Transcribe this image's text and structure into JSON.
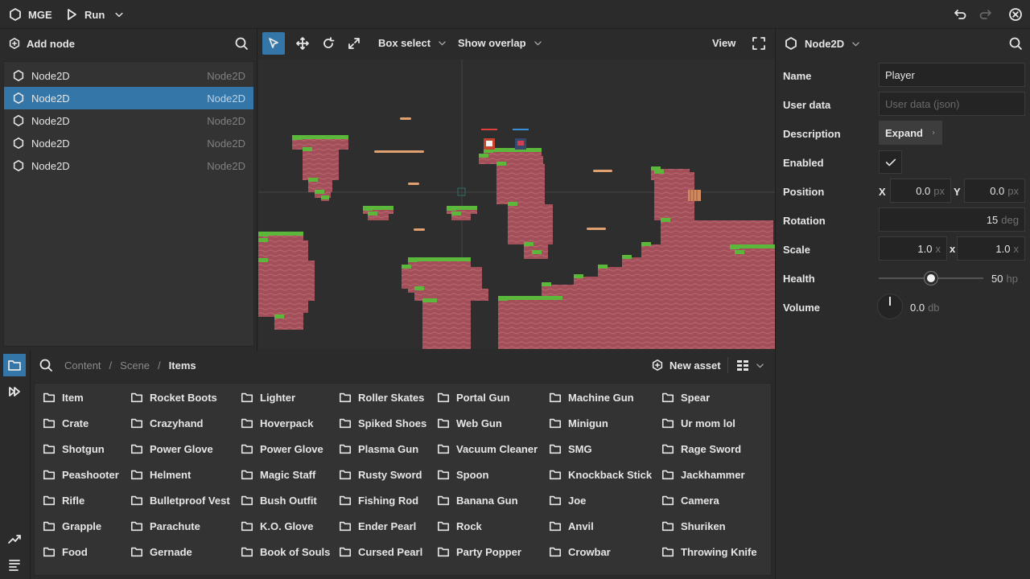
{
  "app": {
    "name": "MGE",
    "run_label": "Run"
  },
  "scene": {
    "add_node_label": "Add node",
    "nodes": [
      {
        "name": "Node2D",
        "type": "Node2D",
        "selected": false
      },
      {
        "name": "Node2D",
        "type": "Node2D",
        "selected": true
      },
      {
        "name": "Node2D",
        "type": "Node2D",
        "selected": false
      },
      {
        "name": "Node2D",
        "type": "Node2D",
        "selected": false
      },
      {
        "name": "Node2D",
        "type": "Node2D",
        "selected": false
      }
    ]
  },
  "viewport": {
    "box_select_label": "Box select",
    "overlap_label": "Show overlap",
    "view_label": "View"
  },
  "assets": {
    "breadcrumb": [
      "Content",
      "Scene",
      "Items"
    ],
    "new_asset_label": "New asset",
    "columns": [
      [
        "Item",
        "Crate",
        "Shotgun",
        "Peashooter",
        "Rifle",
        "Grapple",
        "Food"
      ],
      [
        "Rocket Boots",
        "Crazyhand",
        "Power Glove",
        "Helment",
        "Bulletproof Vest",
        "Parachute",
        "Gernade"
      ],
      [
        "Lighter",
        "Hoverpack",
        "Power Glove",
        "Magic Staff",
        "Bush Outfit",
        "K.O. Glove",
        "Book of Souls"
      ],
      [
        "Roller Skates",
        "Spiked Shoes",
        "Plasma Gun",
        "Rusty Sword",
        "Fishing Rod",
        "Ender Pearl",
        "Cursed Pearl"
      ],
      [
        "Portal Gun",
        "Web Gun",
        "Vacuum Cleaner",
        "Spoon",
        "Banana Gun",
        "Rock",
        "Party Popper"
      ],
      [
        "Machine Gun",
        "Minigun",
        "SMG",
        "Knockback Stick",
        "Joe",
        "Anvil",
        "Crowbar"
      ],
      [
        "Spear",
        "Ur mom lol",
        "Rage Sword",
        "Jackhammer",
        "Camera",
        "Shuriken",
        "Throwing Knife"
      ]
    ]
  },
  "inspector": {
    "title": "Node2D",
    "name_label": "Name",
    "name_value": "Player",
    "userdata_label": "User data",
    "userdata_placeholder": "User data (json)",
    "description_label": "Description",
    "expand_label": "Expand",
    "enabled_label": "Enabled",
    "enabled": true,
    "position_label": "Position",
    "pos_x_label": "X",
    "pos_x": "0.0",
    "pos_y_label": "Y",
    "pos_y": "0.0",
    "pos_unit": "px",
    "rotation_label": "Rotation",
    "rotation": "15",
    "rotation_unit": "deg",
    "scale_label": "Scale",
    "scale_x": "1.0",
    "scale_sep": "x",
    "scale_y": "1.0",
    "scale_unit": "x",
    "health_label": "Health",
    "health": "50",
    "health_unit": "hp",
    "health_fraction": 0.5,
    "volume_label": "Volume",
    "volume": "0.0",
    "volume_unit": "db"
  },
  "colors": {
    "accent": "#3576a8",
    "grass": "#5cb83a",
    "dirt": "#a34f5a",
    "platform": "#e0a070"
  }
}
